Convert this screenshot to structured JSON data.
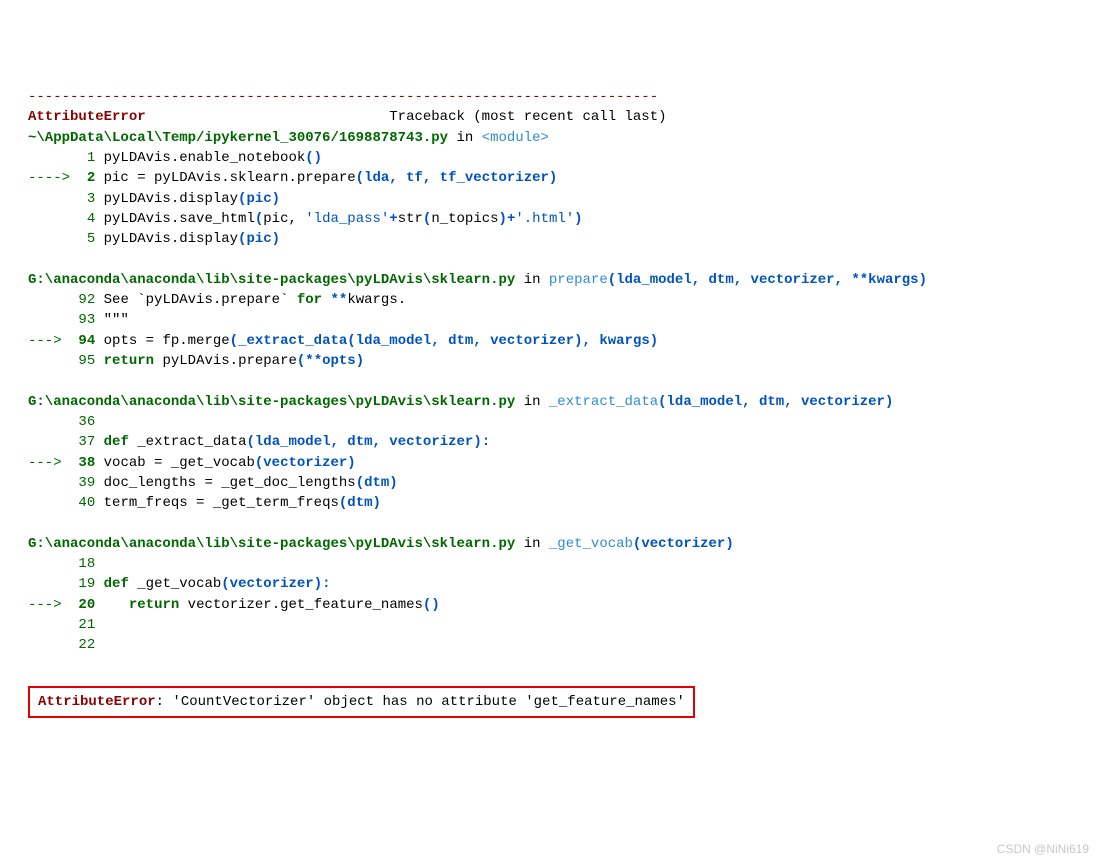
{
  "hr": "---------------------------------------------------------------------------",
  "error_name": "AttributeError",
  "traceback_header": "Traceback (most recent call last)",
  "frames": [
    {
      "path": "~\\AppData\\Local\\Temp/ipykernel_30076/1698878743.py",
      "in": "in",
      "func": "<module>",
      "args": "",
      "lines": [
        {
          "arrow": "",
          "num": "1",
          "code_plain": "pyLDAvis.enable_notebook",
          "tail_punc": "()"
        },
        {
          "arrow": "----> ",
          "num": "2",
          "code_plain": "pic = pyLDAvis.sklearn.prepare",
          "tail_punc": "(lda, tf, tf_vectorizer)"
        },
        {
          "arrow": "",
          "num": "3",
          "code_plain": "pyLDAvis.display",
          "tail_punc": "(pic)"
        },
        {
          "arrow": "",
          "num": "4",
          "code_plain": "pyLDAvis.save_html",
          "tail_save": true
        },
        {
          "arrow": "",
          "num": "5",
          "code_plain": "pyLDAvis.display",
          "tail_punc": "(pic)"
        }
      ],
      "save_html": {
        "open": "(pic, ",
        "str1": "'lda_pass'",
        "plus1": "+str(n_topics)+",
        "str2": "'.html'",
        "close": ")"
      }
    },
    {
      "path": "G:\\anaconda\\anaconda\\lib\\site-packages\\pyLDAvis\\sklearn.py",
      "in": "in",
      "func": "prepare",
      "args": "(lda_model, dtm, vectorizer, **kwargs)",
      "lines": [
        {
          "arrow": "",
          "num": "92",
          "code": "See `pyLDAvis.prepare` ",
          "kw": "for",
          "code2": " ",
          "punc": "**",
          "code3": "kwargs."
        },
        {
          "arrow": "",
          "num": "93",
          "code": "\"\"\""
        },
        {
          "arrow": "---> ",
          "num": "94",
          "code_plain": "opts = fp.merge",
          "tail_punc": "(_extract_data(lda_model, dtm, vectorizer), kwargs)"
        },
        {
          "arrow": "",
          "num": "95",
          "kw_lead": "return",
          "code_plain": " pyLDAvis.prepare",
          "tail_punc": "(**opts)"
        }
      ]
    },
    {
      "path": "G:\\anaconda\\anaconda\\lib\\site-packages\\pyLDAvis\\sklearn.py",
      "in": "in",
      "func": "_extract_data",
      "args": "(lda_model, dtm, vectorizer)",
      "lines": [
        {
          "arrow": "",
          "num": "36",
          "code": ""
        },
        {
          "arrow": "",
          "num": "37",
          "kw_lead": "def",
          "code_plain": " _extract_data",
          "tail_punc": "(lda_model, dtm, vectorizer):"
        },
        {
          "arrow": "---> ",
          "num": "38",
          "code_plain": "vocab = _get_vocab",
          "tail_punc": "(vectorizer)"
        },
        {
          "arrow": "",
          "num": "39",
          "code_plain": "doc_lengths = _get_doc_lengths",
          "tail_punc": "(dtm)"
        },
        {
          "arrow": "",
          "num": "40",
          "code_plain": "term_freqs = _get_term_freqs",
          "tail_punc": "(dtm)"
        }
      ]
    },
    {
      "path": "G:\\anaconda\\anaconda\\lib\\site-packages\\pyLDAvis\\sklearn.py",
      "in": "in",
      "func": "_get_vocab",
      "args": "(vectorizer)",
      "lines": [
        {
          "arrow": "",
          "num": "18",
          "code": ""
        },
        {
          "arrow": "",
          "num": "19",
          "kw_lead": "def",
          "code_plain": " _get_vocab",
          "tail_punc": "(vectorizer):"
        },
        {
          "arrow": "---> ",
          "num": "20",
          "indent": "   ",
          "kw_lead": "return",
          "code_plain": " vectorizer.get_feature_names",
          "tail_punc": "()"
        },
        {
          "arrow": "",
          "num": "21",
          "code": ""
        },
        {
          "arrow": "",
          "num": "22",
          "code": ""
        }
      ]
    }
  ],
  "final_error": {
    "name": "AttributeError",
    "msg": ": 'CountVectorizer' object has no attribute 'get_feature_names'"
  },
  "watermark": "CSDN @NiNi619"
}
